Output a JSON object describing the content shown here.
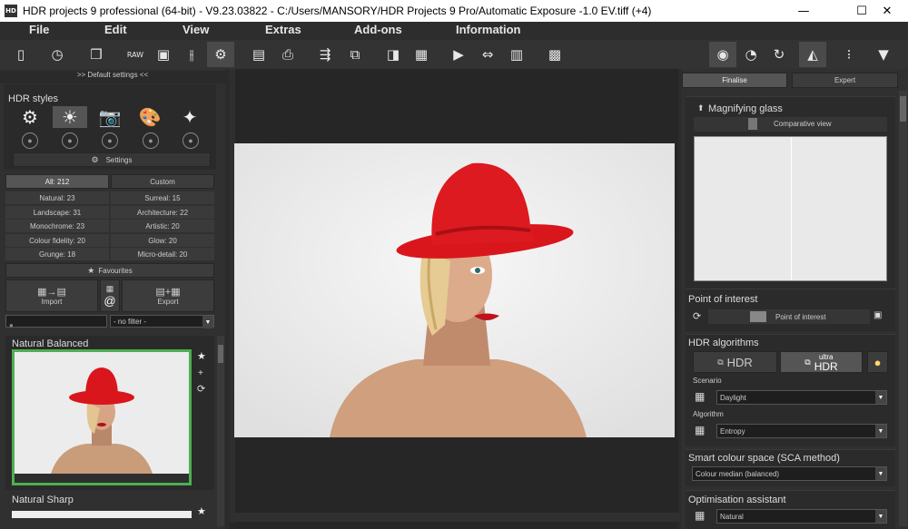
{
  "window": {
    "title": "HDR projects 9 professional (64-bit) - V9.23.03822 - C:/Users/MANSORY/HDR Projects 9 Pro/Automatic Exposure -1.0 EV.tiff (+4)",
    "app_icon": "HD",
    "minimize": "—",
    "maximize": "☐",
    "close": "✕"
  },
  "menu": [
    "File",
    "Edit",
    "View",
    "Extras",
    "Add-ons",
    "Information"
  ],
  "left": {
    "default_settings": ">> Default settings <<",
    "hdr_styles_title": "HDR styles",
    "settings_label": "Settings",
    "tabs": {
      "all": "All: 212",
      "custom": "Custom"
    },
    "categories": [
      [
        "Natural: 23",
        "Surreal: 15"
      ],
      [
        "Landscape: 31",
        "Architecture: 22"
      ],
      [
        "Monochrome: 23",
        "Artistic: 20"
      ],
      [
        "Colour fidelity: 20",
        "Glow: 20"
      ],
      [
        "Grunge: 18",
        "Micro-detail: 20"
      ]
    ],
    "favourites": "Favourites",
    "import_label": "Import",
    "at_label": "@",
    "export_label": "Export",
    "search_placeholder": "",
    "filter": "- no filter -",
    "preset1": "Natural Balanced",
    "preset2": "Natural Sharp"
  },
  "right": {
    "tabs": {
      "finalise": "Finalise",
      "expert": "Expert"
    },
    "magnifier_title": "Magnifying glass",
    "comparative": "Comparative view",
    "poi_title": "Point of interest",
    "poi_btn": "Point of interest",
    "algo_title": "HDR algorithms",
    "hdr_btn": "HDR",
    "ultra_top": "ultra",
    "ultra_bottom": "HDR",
    "scenario_label": "Scenario",
    "scenario_value": "Daylight",
    "algorithm_label": "Algorithm",
    "algorithm_value": "Entropy",
    "sca_title": "Smart colour space (SCA method)",
    "sca_value": "Colour median (balanced)",
    "opt_title": "Optimisation assistant",
    "opt_value": "Natural"
  },
  "colors": {
    "accent_green": "#4caf50",
    "hat_red": "#d9161c"
  }
}
